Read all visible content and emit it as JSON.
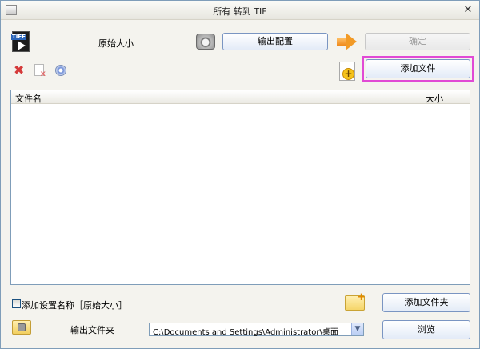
{
  "window": {
    "title": "所有 转到 TIF",
    "close_glyph": "✕"
  },
  "top": {
    "preset_label": "原始大小",
    "output_config_label": "输出配置",
    "ok_label": "确定",
    "add_file_label": "添加文件"
  },
  "list": {
    "columns": [
      "文件名",
      "大小"
    ],
    "rows": []
  },
  "bottom": {
    "add_setting_label": "添加设置名称［原始大小］",
    "add_setting_checked": false,
    "add_folder_label": "添加文件夹",
    "output_folder_label": "输出文件夹",
    "output_path": "C:\\Documents and Settings\\Administrator\\桌面",
    "browse_label": "浏览"
  },
  "icons": {
    "tiff": "tiff-format-icon",
    "camera": "output-config-icon",
    "arrow": "arrow-right-icon",
    "delete": "delete-icon",
    "remove_page": "remove-page-icon",
    "media": "media-icon",
    "add_file": "add-file-icon",
    "add_folder": "add-folder-icon",
    "folder": "folder-icon"
  },
  "colors": {
    "highlight": "#e14ad5",
    "window_bg": "#f4f3ee",
    "button_border": "#7a95c2"
  }
}
